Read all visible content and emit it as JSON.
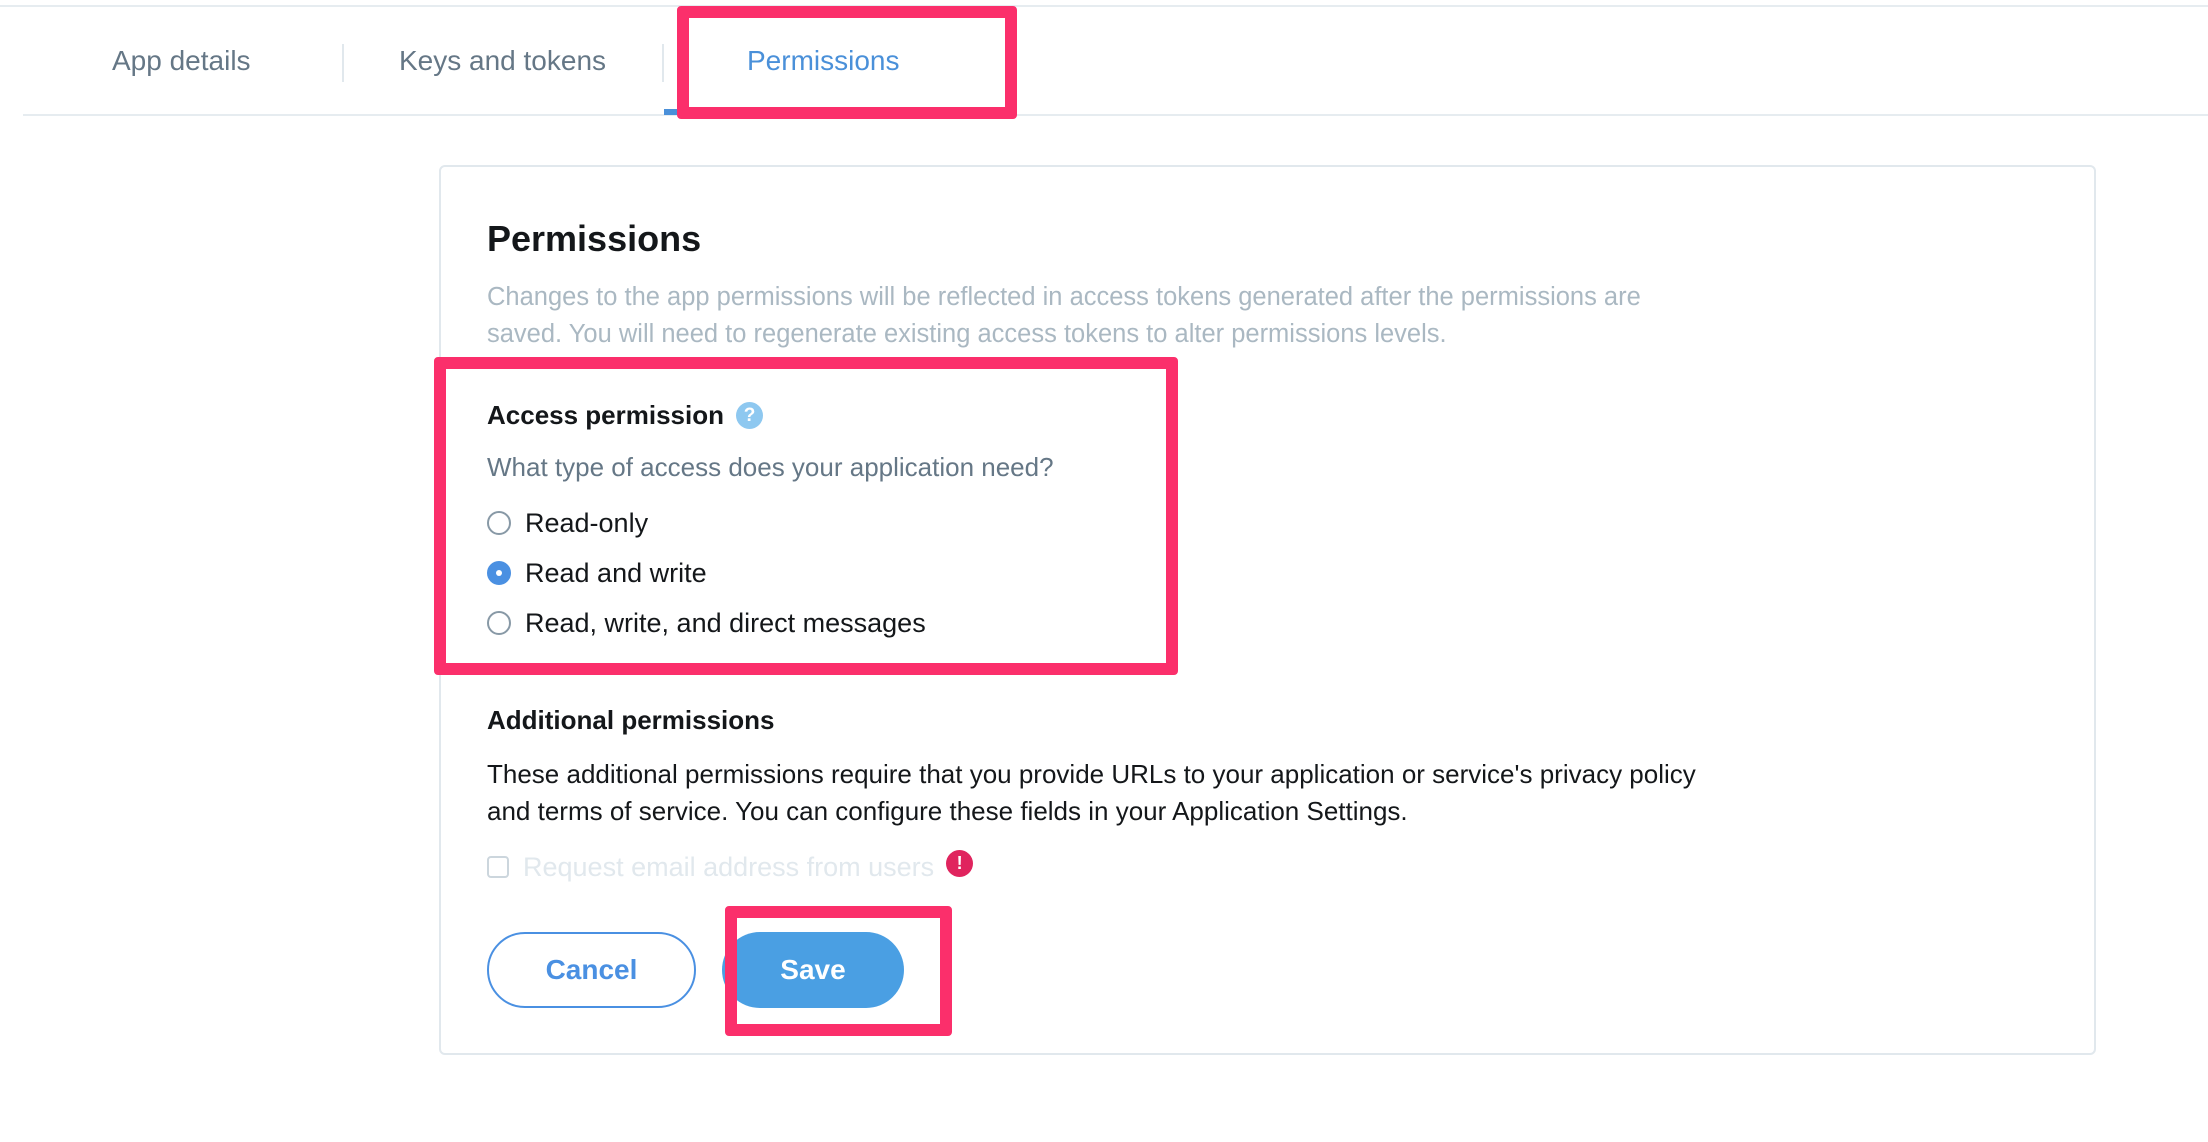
{
  "tabs": [
    {
      "label": "App details",
      "active": false
    },
    {
      "label": "Keys and tokens",
      "active": false
    },
    {
      "label": "Permissions",
      "active": true
    }
  ],
  "permissions": {
    "title": "Permissions",
    "intro": "Changes to the app permissions will be reflected in access tokens generated after the permissions are saved. You will need to regenerate existing access tokens to alter permissions levels.",
    "access": {
      "heading": "Access permission",
      "help_icon": "question-mark-icon",
      "question": "What type of access does your application need?",
      "options": [
        {
          "label": "Read-only",
          "selected": false
        },
        {
          "label": "Read and write",
          "selected": true
        },
        {
          "label": "Read, write, and direct messages",
          "selected": false
        }
      ]
    },
    "additional": {
      "heading": "Additional permissions",
      "description": "These additional permissions require that you provide URLs to your application or service's privacy policy and terms of service. You can configure these fields in your Application Settings.",
      "email_checkbox_label": "Request email address from users",
      "email_checkbox_checked": false,
      "email_checkbox_disabled": true,
      "alert_icon": "exclamation-icon"
    },
    "actions": {
      "cancel_label": "Cancel",
      "save_label": "Save"
    }
  },
  "colors": {
    "accent": "#4a90e2",
    "highlight": "#fb2f6b",
    "alert": "#e0245e",
    "muted_text": "#aab8c2"
  }
}
